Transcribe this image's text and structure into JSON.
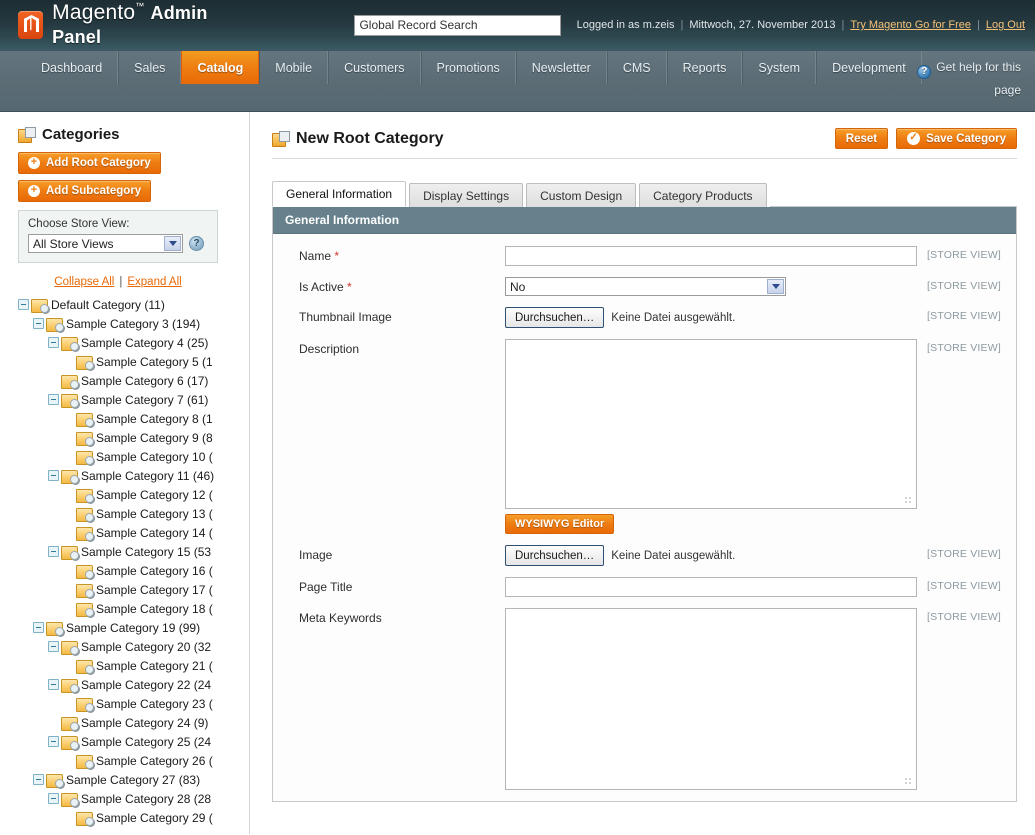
{
  "header": {
    "logo_text_light": "Magento",
    "logo_tm": "™",
    "logo_text_bold": "Admin Panel",
    "logo_icon": "magento-logo-icon",
    "search_placeholder": "Global Record Search",
    "search_value": "Global Record Search",
    "logged_in_as": "Logged in as m.zeis",
    "date": "Mittwoch, 27. November 2013",
    "try_link": "Try Magento Go for Free",
    "logout_link": "Log Out",
    "separator": "|"
  },
  "nav": {
    "items": [
      {
        "label": "Dashboard",
        "active": false
      },
      {
        "label": "Sales",
        "active": false
      },
      {
        "label": "Catalog",
        "active": true
      },
      {
        "label": "Mobile",
        "active": false
      },
      {
        "label": "Customers",
        "active": false
      },
      {
        "label": "Promotions",
        "active": false
      },
      {
        "label": "Newsletter",
        "active": false
      },
      {
        "label": "CMS",
        "active": false
      },
      {
        "label": "Reports",
        "active": false
      },
      {
        "label": "System",
        "active": false
      },
      {
        "label": "Development",
        "active": false
      }
    ],
    "help_line1": "Get help for this",
    "help_line2": "page",
    "help_icon": "question-mark-icon"
  },
  "sidebar": {
    "title": "Categories",
    "title_icon": "category-icon",
    "add_root_label": "Add Root Category",
    "add_sub_label": "Add Subcategory",
    "store_view_label": "Choose Store View:",
    "store_view_value": "All Store Views",
    "collapse_all": "Collapse All",
    "expand_all": "Expand All",
    "links_separator": "|",
    "tree": [
      {
        "label": "Default Category (11)",
        "depth": 0,
        "toggle": true
      },
      {
        "label": "Sample Category 3 (194)",
        "depth": 1,
        "toggle": true
      },
      {
        "label": "Sample Category 4 (25)",
        "depth": 2,
        "toggle": true
      },
      {
        "label": "Sample Category 5 (1",
        "depth": 3,
        "toggle": false
      },
      {
        "label": "Sample Category 6 (17)",
        "depth": 2,
        "toggle": false
      },
      {
        "label": "Sample Category 7 (61)",
        "depth": 2,
        "toggle": true
      },
      {
        "label": "Sample Category 8 (1",
        "depth": 3,
        "toggle": false
      },
      {
        "label": "Sample Category 9 (8",
        "depth": 3,
        "toggle": false
      },
      {
        "label": "Sample Category 10 (",
        "depth": 3,
        "toggle": false
      },
      {
        "label": "Sample Category 11 (46)",
        "depth": 2,
        "toggle": true
      },
      {
        "label": "Sample Category 12 (",
        "depth": 3,
        "toggle": false
      },
      {
        "label": "Sample Category 13 (",
        "depth": 3,
        "toggle": false
      },
      {
        "label": "Sample Category 14 (",
        "depth": 3,
        "toggle": false
      },
      {
        "label": "Sample Category 15 (53",
        "depth": 2,
        "toggle": true
      },
      {
        "label": "Sample Category 16 (",
        "depth": 3,
        "toggle": false
      },
      {
        "label": "Sample Category 17 (",
        "depth": 3,
        "toggle": false
      },
      {
        "label": "Sample Category 18 (",
        "depth": 3,
        "toggle": false
      },
      {
        "label": "Sample Category 19 (99)",
        "depth": 1,
        "toggle": true
      },
      {
        "label": "Sample Category 20 (32",
        "depth": 2,
        "toggle": true
      },
      {
        "label": "Sample Category 21 (",
        "depth": 3,
        "toggle": false
      },
      {
        "label": "Sample Category 22 (24",
        "depth": 2,
        "toggle": true
      },
      {
        "label": "Sample Category 23 (",
        "depth": 3,
        "toggle": false
      },
      {
        "label": "Sample Category 24 (9)",
        "depth": 2,
        "toggle": false
      },
      {
        "label": "Sample Category 25 (24",
        "depth": 2,
        "toggle": true
      },
      {
        "label": "Sample Category 26 (",
        "depth": 3,
        "toggle": false
      },
      {
        "label": "Sample Category 27 (83)",
        "depth": 1,
        "toggle": true
      },
      {
        "label": "Sample Category 28 (28",
        "depth": 2,
        "toggle": true
      },
      {
        "label": "Sample Category 29 (",
        "depth": 3,
        "toggle": false
      }
    ]
  },
  "content": {
    "page_title": "New Root Category",
    "page_title_icon": "category-icon",
    "reset_label": "Reset",
    "save_label": "Save Category",
    "save_icon": "check-circle-icon",
    "tabs": [
      {
        "label": "General Information",
        "active": true
      },
      {
        "label": "Display Settings",
        "active": false
      },
      {
        "label": "Custom Design",
        "active": false
      },
      {
        "label": "Category Products",
        "active": false
      }
    ],
    "panel_title": "General Information",
    "scope_label": "[STORE VIEW]",
    "file_button_label": "Durchsuchen…",
    "file_none_label": "Keine Datei ausgewählt.",
    "wysiwyg_label": "WYSIWYG Editor",
    "fields": {
      "name_label": "Name",
      "name_value": "",
      "is_active_label": "Is Active",
      "is_active_value": "No",
      "thumbnail_label": "Thumbnail Image",
      "description_label": "Description",
      "description_value": "",
      "image_label": "Image",
      "page_title_label": "Page Title",
      "page_title_value": "",
      "meta_keywords_label": "Meta Keywords",
      "meta_keywords_value": ""
    }
  },
  "colors": {
    "accent_orange": "#ee7d12",
    "header_dark": "#1d2d33",
    "nav_gray": "#5b6c75",
    "panel_head": "#66808c",
    "required_red": "#d4342b",
    "link_orange": "#e96a08"
  }
}
